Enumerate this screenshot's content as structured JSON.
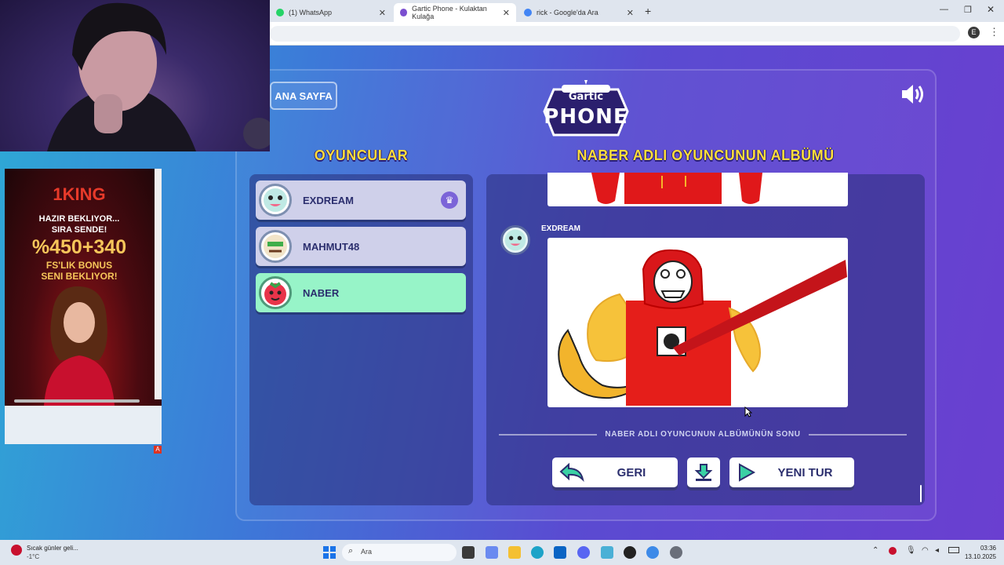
{
  "browser": {
    "tabs": [
      {
        "label": "(1) WhatsApp",
        "favicon": "whatsapp-icon",
        "color": "#25d366"
      },
      {
        "label": "Gartic Phone - Kulaktan Kulağa",
        "favicon": "gartic-icon",
        "color": "#7b4fd0"
      },
      {
        "label": "rick - Google'da Ara",
        "favicon": "google-icon",
        "color": "#4285f4"
      }
    ],
    "profile_initial": "E"
  },
  "game": {
    "home_button": "ANA SAYFA",
    "logo_top": "Gartic",
    "logo_main": "PHONE",
    "players_heading": "OYUNCULAR",
    "album_heading": "NABER ADLI OYUNCUNUN ALBÜMÜ",
    "players": [
      {
        "name": "EXDREAM",
        "host": true,
        "selected": false
      },
      {
        "name": "MAHMUT48",
        "host": false,
        "selected": false
      },
      {
        "name": "NABER",
        "host": false,
        "selected": true
      }
    ],
    "entry_author": "EXDREAM",
    "album_end_text": "NABER ADLI OYUNCUNUN ALBÜMÜNÜN SONU",
    "back_button": "GERI",
    "new_round_button": "YENI TUR",
    "colors": {
      "heading": "#ffde3a",
      "selected_player": "#97f4c8",
      "player": "#cfd0ea"
    }
  },
  "ad": {
    "brand": "1KING",
    "line1": "HAZIR BEKLIYOR...",
    "line2": "SIRA SENDE!",
    "offer": "%450+340",
    "line3": "FS'LIK BONUS",
    "line4": "SENI BEKLIYOR!"
  },
  "taskbar": {
    "weather_title": "Sıcak günler geli...",
    "weather_temp": "-1°C",
    "search_placeholder": "Ara",
    "time": "03:36",
    "date": "13.10.2025"
  }
}
